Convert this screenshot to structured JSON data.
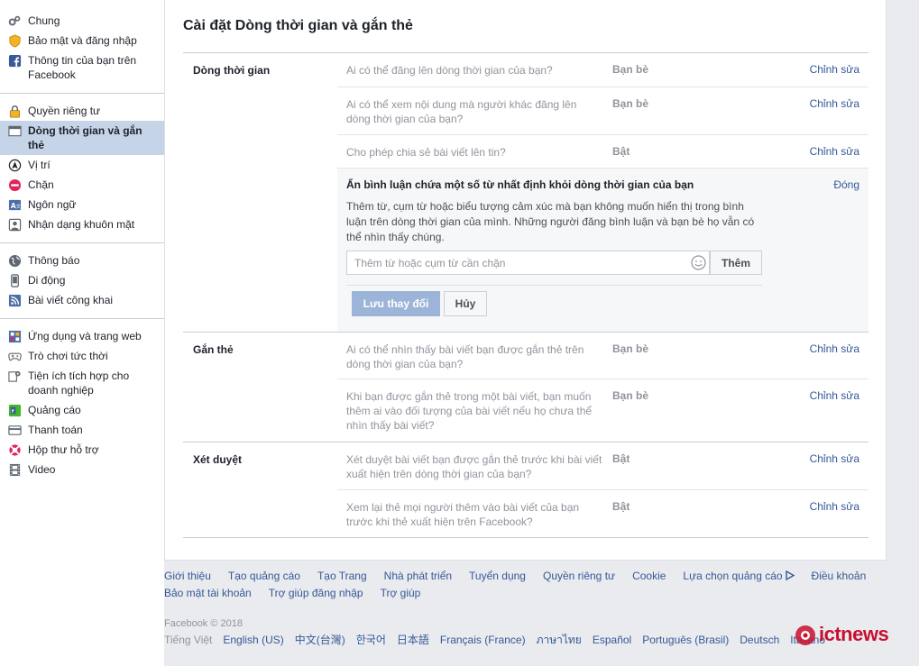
{
  "sidebar": {
    "groups": [
      {
        "items": [
          {
            "label": "Chung",
            "icon": "gears-icon"
          },
          {
            "label": "Bảo mật và đăng nhập",
            "icon": "shield-icon"
          },
          {
            "label": "Thông tin của bạn trên Facebook",
            "icon": "facebook-icon"
          }
        ]
      },
      {
        "items": [
          {
            "label": "Quyền riêng tư",
            "icon": "lock-icon"
          },
          {
            "label": "Dòng thời gian và gắn thẻ",
            "icon": "timeline-icon",
            "active": true
          },
          {
            "label": "Vị trí",
            "icon": "location-icon"
          },
          {
            "label": "Chặn",
            "icon": "block-icon"
          },
          {
            "label": "Ngôn ngữ",
            "icon": "language-icon"
          },
          {
            "label": "Nhận dạng khuôn mặt",
            "icon": "face-icon"
          }
        ]
      },
      {
        "items": [
          {
            "label": "Thông báo",
            "icon": "globe-icon"
          },
          {
            "label": "Di động",
            "icon": "mobile-icon"
          },
          {
            "label": "Bài viết công khai",
            "icon": "rss-icon"
          }
        ]
      },
      {
        "items": [
          {
            "label": "Ứng dụng và trang web",
            "icon": "apps-icon"
          },
          {
            "label": "Trò chơi tức thời",
            "icon": "gamepad-icon"
          },
          {
            "label": "Tiện ích tích hợp cho doanh nghiệp",
            "icon": "business-gear-icon"
          },
          {
            "label": "Quảng cáo",
            "icon": "ads-icon"
          },
          {
            "label": "Thanh toán",
            "icon": "card-icon"
          },
          {
            "label": "Hộp thư hỗ trợ",
            "icon": "lifebuoy-icon"
          },
          {
            "label": "Video",
            "icon": "film-icon"
          }
        ]
      }
    ]
  },
  "main": {
    "title": "Cài đặt Dòng thời gian và gắn thẻ",
    "sections": {
      "timeline": {
        "label": "Dòng thời gian",
        "rows": [
          {
            "question": "Ai có thể đăng lên dòng thời gian của bạn?",
            "value": "Bạn bè",
            "edit": "Chỉnh sửa"
          },
          {
            "question": "Ai có thể xem nội dung mà người khác đăng lên dòng thời gian của bạn?",
            "value": "Bạn bè",
            "edit": "Chỉnh sửa"
          },
          {
            "question": "Cho phép chia sẻ bài viết lên tin?",
            "value": "Bật",
            "edit": "Chỉnh sửa"
          }
        ],
        "expanded": {
          "title": "Ẩn bình luận chứa một số từ nhất định khỏi dòng thời gian của bạn",
          "close": "Đóng",
          "description": "Thêm từ, cụm từ hoặc biểu tượng cảm xúc mà bạn không muốn hiển thị trong bình luận trên dòng thời gian của mình. Những người đăng bình luận và bạn bè họ vẫn có thể nhìn thấy chúng.",
          "input_value": "",
          "input_placeholder": "Thêm từ hoặc cụm từ cần chặn",
          "add_label": "Thêm",
          "save_label": "Lưu thay đổi",
          "cancel_label": "Hủy"
        }
      },
      "tagging": {
        "label": "Gắn thẻ",
        "rows": [
          {
            "question": "Ai có thể nhìn thấy bài viết bạn được gắn thẻ trên dòng thời gian của bạn?",
            "value": "Bạn bè",
            "edit": "Chỉnh sửa"
          },
          {
            "question": "Khi bạn được gắn thẻ trong một bài viết, bạn muốn thêm ai vào đối tượng của bài viết nếu họ chưa thể nhìn thấy bài viết?",
            "value": "Bạn bè",
            "edit": "Chỉnh sửa"
          }
        ]
      },
      "review": {
        "label": "Xét duyệt",
        "rows": [
          {
            "question": "Xét duyệt bài viết bạn được gắn thẻ trước khi bài viết xuất hiện trên dòng thời gian của bạn?",
            "value": "Bật",
            "edit": "Chỉnh sửa"
          },
          {
            "question": "Xem lại thẻ mọi người thêm vào bài viết của bạn trước khi thẻ xuất hiện trên Facebook?",
            "value": "Bật",
            "edit": "Chỉnh sửa"
          }
        ]
      }
    }
  },
  "footer": {
    "links": [
      "Giới thiệu",
      "Tạo quảng cáo",
      "Tạo Trang",
      "Nhà phát triển",
      "Tuyển dụng",
      "Quyền riêng tư",
      "Cookie",
      "Lựa chọn quảng cáo",
      "Điều khoản",
      "Bảo mật tài khoản",
      "Trợ giúp đăng nhập",
      "Trợ giúp"
    ],
    "copyright": "Facebook © 2018",
    "languages": [
      "Tiếng Việt",
      "English (US)",
      "中文(台灣)",
      "한국어",
      "日本語",
      "Français (France)",
      "ภาษาไทย",
      "Español",
      "Português (Brasil)",
      "Deutsch",
      "Italiano"
    ]
  },
  "watermark": {
    "text": "ictnews",
    "color": "#c8102e"
  },
  "colors": {
    "link": "#365899",
    "active_bg": "#c6d4e8",
    "save_disabled": "#9cb4d8",
    "muted": "#90949c"
  }
}
